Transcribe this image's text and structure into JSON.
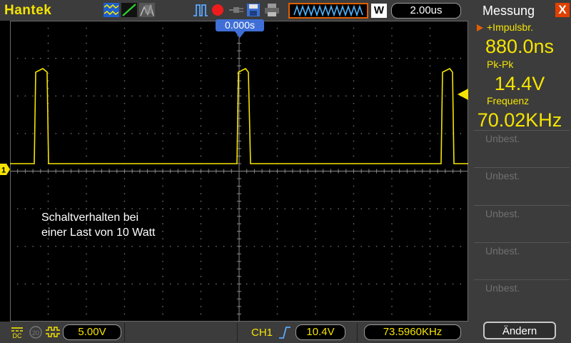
{
  "header": {
    "brand": "Hantek",
    "timebase": "2.00us",
    "icons": [
      "waveform-mode-icon",
      "ramp-icon",
      "persist-icon",
      "trigger-pulse-icon",
      "record-icon",
      "connector-icon",
      "save-icon",
      "print-icon",
      "waveform-memory-icon",
      "w-icon"
    ],
    "w_label": "W"
  },
  "screen": {
    "time_marker": "0.000s",
    "annotation_line1": "Schaltverhalten bei",
    "annotation_line2": "einer Last von 10 Watt",
    "channel_marker": "1"
  },
  "bottom": {
    "ch1_volt": "5.00V",
    "trigger_channel": "CH1",
    "trigger_level": "10.4V",
    "frequency": "73.5960KHz",
    "coupling": "DC",
    "bandwidth": "20",
    "icon_names": [
      "dc-coupling-icon",
      "bandwidth-limit-icon",
      "invert-icon",
      "trigger-edge-icon"
    ]
  },
  "panel": {
    "title": "Messung",
    "close": "X",
    "measurements": [
      {
        "label": "+Impulsbr.",
        "value": "880.0ns"
      },
      {
        "label": "Pk-Pk",
        "value": "14.4V"
      },
      {
        "label": "Frequenz",
        "value": "70.02KHz"
      }
    ],
    "empty_slots": [
      "Unbest.",
      "Unbest.",
      "Unbest.",
      "Unbest.",
      "Unbest."
    ],
    "change_button": "Ändern"
  },
  "colors": {
    "trace": "#f5e400",
    "accent": "#e04000",
    "marker": "#3f6fd6"
  }
}
